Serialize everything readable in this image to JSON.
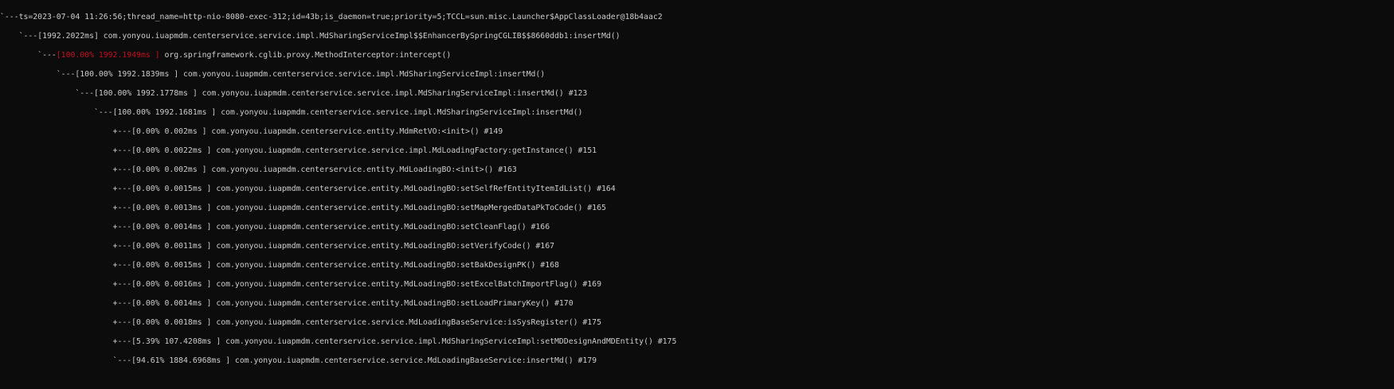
{
  "colors": {
    "background": "#0c0c0c",
    "foreground": "#cccccc",
    "highlight_red": "#c50f1f"
  },
  "trace": {
    "lines": [
      {
        "prefix": "`---",
        "hl": "",
        "text": "ts=2023-07-04 11:26:56;thread_name=http-nio-8080-exec-312;id=43b;is_daemon=true;priority=5;TCCL=sun.misc.Launcher$AppClassLoader@18b4aac2"
      },
      {
        "prefix": "    `---",
        "hl": "",
        "text": "[1992.2022ms] com.yonyou.iuapmdm.centerservice.service.impl.MdSharingServiceImpl$$EnhancerBySpringCGLIB$$8660ddb1:insertMd()"
      },
      {
        "prefix": "        `---",
        "hl": "[100.00% 1992.1949ms ]",
        "text": " org.springframework.cglib.proxy.MethodInterceptor:intercept()"
      },
      {
        "prefix": "            `---",
        "hl": "",
        "text": "[100.00% 1992.1839ms ] com.yonyou.iuapmdm.centerservice.service.impl.MdSharingServiceImpl:insertMd()"
      },
      {
        "prefix": "                `---",
        "hl": "",
        "text": "[100.00% 1992.1778ms ] com.yonyou.iuapmdm.centerservice.service.impl.MdSharingServiceImpl:insertMd() #123"
      },
      {
        "prefix": "                    `---",
        "hl": "",
        "text": "[100.00% 1992.1681ms ] com.yonyou.iuapmdm.centerservice.service.impl.MdSharingServiceImpl:insertMd()"
      },
      {
        "prefix": "                        +---",
        "hl": "",
        "text": "[0.00% 0.002ms ] com.yonyou.iuapmdm.centerservice.entity.MdmRetVO:<init>() #149"
      },
      {
        "prefix": "                        +---",
        "hl": "",
        "text": "[0.00% 0.0022ms ] com.yonyou.iuapmdm.centerservice.service.impl.MdLoadingFactory:getInstance() #151"
      },
      {
        "prefix": "                        +---",
        "hl": "",
        "text": "[0.00% 0.002ms ] com.yonyou.iuapmdm.centerservice.entity.MdLoadingBO:<init>() #163"
      },
      {
        "prefix": "                        +---",
        "hl": "",
        "text": "[0.00% 0.0015ms ] com.yonyou.iuapmdm.centerservice.entity.MdLoadingBO:setSelfRefEntityItemIdList() #164"
      },
      {
        "prefix": "                        +---",
        "hl": "",
        "text": "[0.00% 0.0013ms ] com.yonyou.iuapmdm.centerservice.entity.MdLoadingBO:setMapMergedDataPkToCode() #165"
      },
      {
        "prefix": "                        +---",
        "hl": "",
        "text": "[0.00% 0.0014ms ] com.yonyou.iuapmdm.centerservice.entity.MdLoadingBO:setCleanFlag() #166"
      },
      {
        "prefix": "                        +---",
        "hl": "",
        "text": "[0.00% 0.0011ms ] com.yonyou.iuapmdm.centerservice.entity.MdLoadingBO:setVerifyCode() #167"
      },
      {
        "prefix": "                        +---",
        "hl": "",
        "text": "[0.00% 0.0015ms ] com.yonyou.iuapmdm.centerservice.entity.MdLoadingBO:setBakDesignPK() #168"
      },
      {
        "prefix": "                        +---",
        "hl": "",
        "text": "[0.00% 0.0016ms ] com.yonyou.iuapmdm.centerservice.entity.MdLoadingBO:setExcelBatchImportFlag() #169"
      },
      {
        "prefix": "                        +---",
        "hl": "",
        "text": "[0.00% 0.0014ms ] com.yonyou.iuapmdm.centerservice.entity.MdLoadingBO:setLoadPrimaryKey() #170"
      },
      {
        "prefix": "                        +---",
        "hl": "",
        "text": "[0.00% 0.0018ms ] com.yonyou.iuapmdm.centerservice.service.MdLoadingBaseService:isSysRegister() #175"
      },
      {
        "prefix": "                        +---",
        "hl": "",
        "text": "[5.39% 107.4208ms ] com.yonyou.iuapmdm.centerservice.service.impl.MdSharingServiceImpl:setMDDesignAndMDEntity() #175"
      },
      {
        "prefix": "                        `---",
        "hl": "",
        "text": "[94.61% 1884.6968ms ] com.yonyou.iuapmdm.centerservice.service.MdLoadingBaseService:insertMd() #179"
      }
    ]
  }
}
